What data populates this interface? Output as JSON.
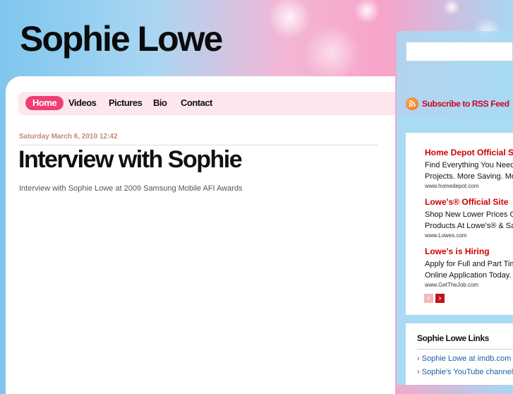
{
  "site": {
    "title": "Sophie Lowe"
  },
  "nav": {
    "items": [
      {
        "label": "Home",
        "active": true
      },
      {
        "label": "Videos"
      },
      {
        "label": "Pictures"
      },
      {
        "label": "Bio"
      },
      {
        "label": "Contact"
      }
    ]
  },
  "post": {
    "date": "Saturday March 6, 2010 12:42",
    "title": "Interview with Sophie",
    "body": "Interview with Sophie Lowe at 2009 Samsung Mobile AFI Awards"
  },
  "sidebar": {
    "search": {
      "value": ""
    },
    "rss": {
      "label": "Subscribe to RSS Feed",
      "icon": "rss-icon"
    },
    "ads": [
      {
        "title": "Home Depot Official Site",
        "line1": "Find Everything You Need For Your",
        "line2": "Projects. More Saving. More Doing.",
        "url": "www.homedepot.com"
      },
      {
        "title": "Lowe's® Official Site",
        "line1": "Shop New Lower Prices On Select",
        "line2": "Products At Lowe's® & Save Today!",
        "url": "www.Lowes.com"
      },
      {
        "title": "Lowe's is Hiring",
        "line1": "Apply for Full and Part Time Jobs.",
        "line2": "Online Application Today. Apply Now!",
        "url": "www.GetTheJob.com"
      }
    ],
    "ad_nav": {
      "prev": "‹",
      "next": "›"
    },
    "links": {
      "title": "Sophie Lowe Links",
      "items": [
        {
          "chevron": "›",
          "label": "Sophie Lowe at imdb.com"
        },
        {
          "chevron": "›",
          "label": "Sophie's YouTube channel"
        }
      ]
    }
  },
  "colors": {
    "accent": "#ef3e74",
    "ad_title": "#cc0000",
    "link": "#1b5fa6",
    "sidebar_bg": "#a9dbf4"
  }
}
